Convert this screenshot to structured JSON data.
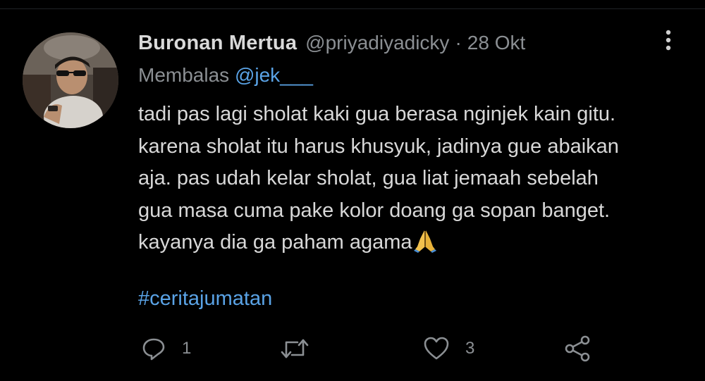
{
  "tweet": {
    "display_name": "Buronan Mertua",
    "handle": "@priyadiyadicky",
    "separator": "·",
    "date": "28 Okt",
    "reply_prefix": "Membalas",
    "reply_to": "@jek___",
    "text_lines": [
      "tadi pas lagi sholat kaki gua berasa nginjek kain gitu.",
      "karena sholat itu harus khusyuk, jadinya gue abaikan",
      "aja. pas udah kelar sholat, gua liat jemaah sebelah",
      "gua masa cuma pake kolor doang ga sopan banget.",
      "kayanya dia ga paham agama"
    ],
    "emoji": "folded-hands-emoji",
    "hashtag": "#ceritajumatan"
  },
  "actions": {
    "reply": {
      "icon": "reply-icon",
      "count": "1"
    },
    "retweet": {
      "icon": "retweet-icon"
    },
    "like": {
      "icon": "heart-icon",
      "count": "3"
    },
    "share": {
      "icon": "share-icon"
    }
  },
  "colors": {
    "background": "#000000",
    "name": "#d9d9d9",
    "secondary": "#8b8f93",
    "link": "#5aa3e6",
    "body_text": "#d8d8d8"
  }
}
